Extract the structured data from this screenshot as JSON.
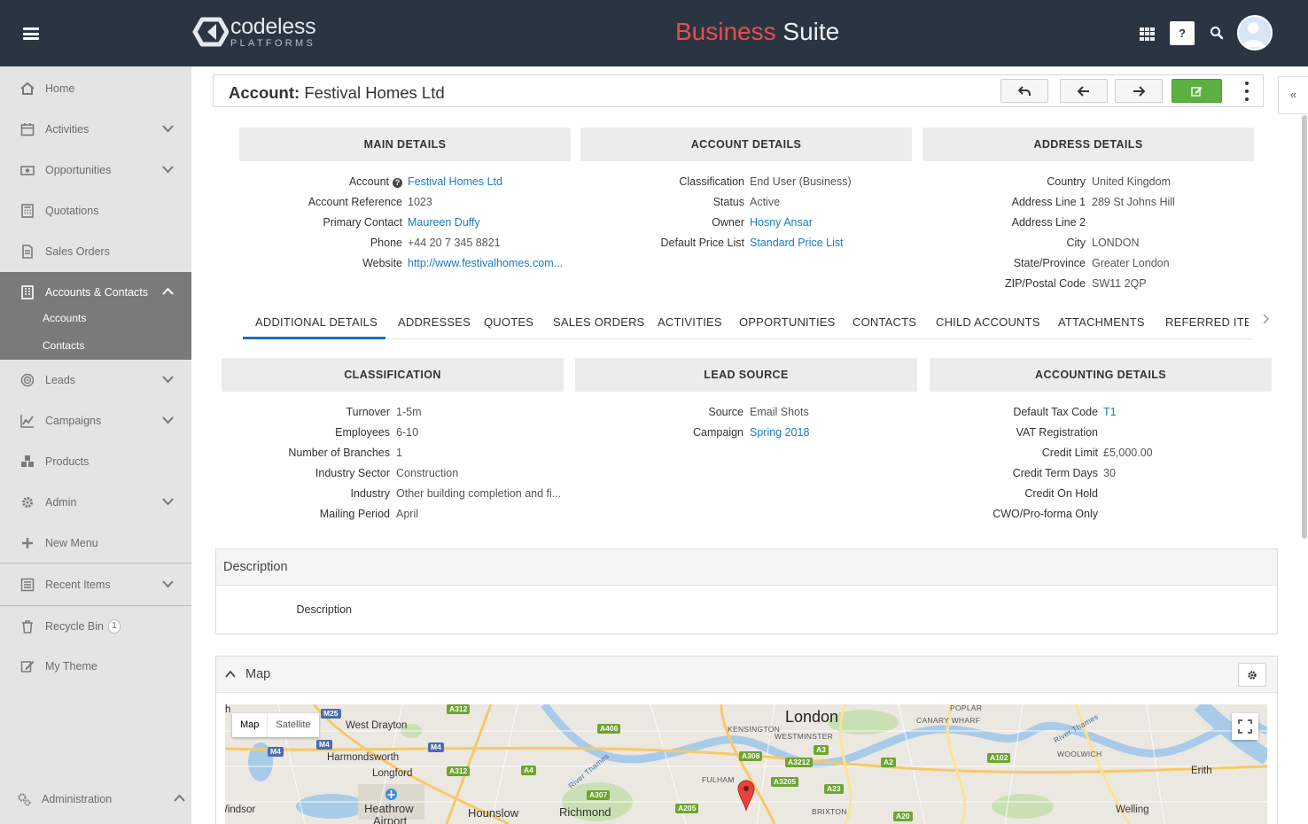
{
  "app": {
    "logo_main": "codeless",
    "logo_sub": "PLATFORMS",
    "title_part1": "Business",
    "title_part2": " Suite",
    "help_label": "?"
  },
  "colors": {
    "topbar": "#2b3542",
    "accent_red": "#e84d4d",
    "link": "#1a7bc4",
    "active_nav": "#7a7a7a",
    "active_indicator": "#1f6fb6",
    "edit_button": "#5cb040"
  },
  "sidebar": {
    "items": [
      {
        "label": "Home",
        "icon": "home-icon"
      },
      {
        "label": "Activities",
        "icon": "calendar-icon"
      },
      {
        "label": "Opportunities",
        "icon": "money-icon"
      },
      {
        "label": "Quotations",
        "icon": "calculator-icon"
      },
      {
        "label": "Sales Orders",
        "icon": "document-icon"
      },
      {
        "label": "Accounts & Contacts",
        "icon": "building-icon"
      },
      {
        "label": "Leads",
        "icon": "target-icon"
      },
      {
        "label": "Campaigns",
        "icon": "line-chart-icon"
      },
      {
        "label": "Products",
        "icon": "cubes-icon"
      },
      {
        "label": "Admin",
        "icon": "gear-icon"
      },
      {
        "label": "New Menu",
        "icon": "plus-icon"
      },
      {
        "label": "Recent Items",
        "icon": "list-icon"
      },
      {
        "label": "Recycle Bin",
        "icon": "trash-icon",
        "badge": "1"
      },
      {
        "label": "My Theme",
        "icon": "edit-icon"
      }
    ],
    "sub_items": [
      "Accounts",
      "Contacts"
    ],
    "footer_label": "Administration"
  },
  "record": {
    "type_label": "Account:",
    "name": "Festival Homes Ltd"
  },
  "sections": {
    "main_details": {
      "title": "MAIN DETAILS",
      "fields": [
        {
          "label": "Account",
          "value": "Festival Homes Ltd",
          "link": true,
          "help": true
        },
        {
          "label": "Account Reference",
          "value": "1023"
        },
        {
          "label": "Primary Contact",
          "value": "Maureen Duffy",
          "link": true
        },
        {
          "label": "Phone",
          "value": "+44 20 7 345 8821"
        },
        {
          "label": "Website",
          "value": "http://www.festivalhomes.com...",
          "link": true
        }
      ]
    },
    "account_details": {
      "title": "ACCOUNT DETAILS",
      "fields": [
        {
          "label": "Classification",
          "value": "End User (Business)"
        },
        {
          "label": "Status",
          "value": "Active"
        },
        {
          "label": "Owner",
          "value": "Hosny Ansar",
          "link": true
        },
        {
          "label": "Default Price List",
          "value": "Standard Price List",
          "link": true
        }
      ]
    },
    "address_details": {
      "title": "ADDRESS DETAILS",
      "fields": [
        {
          "label": "Country",
          "value": "United Kingdom"
        },
        {
          "label": "Address Line 1",
          "value": "289 St Johns Hill"
        },
        {
          "label": "Address Line 2",
          "value": ""
        },
        {
          "label": "City",
          "value": "LONDON"
        },
        {
          "label": "State/Province",
          "value": "Greater London"
        },
        {
          "label": "ZIP/Postal Code",
          "value": "SW11 2QP"
        }
      ]
    }
  },
  "tabs": [
    "ADDITIONAL DETAILS",
    "ADDRESSES",
    "QUOTES",
    "SALES ORDERS",
    "ACTIVITIES",
    "OPPORTUNITIES",
    "CONTACTS",
    "CHILD ACCOUNTS",
    "ATTACHMENTS",
    "REFERRED ITEMS"
  ],
  "additional": {
    "classification": {
      "title": "CLASSIFICATION",
      "fields": [
        {
          "label": "Turnover",
          "value": "1-5m"
        },
        {
          "label": "Employees",
          "value": "6-10"
        },
        {
          "label": "Number of Branches",
          "value": "1"
        },
        {
          "label": "Industry Sector",
          "value": "Construction"
        },
        {
          "label": "Industry",
          "value": "Other building completion and fi..."
        },
        {
          "label": "Mailing Period",
          "value": "April"
        }
      ]
    },
    "lead_source": {
      "title": "LEAD SOURCE",
      "fields": [
        {
          "label": "Source",
          "value": "Email Shots"
        },
        {
          "label": "Campaign",
          "value": "Spring 2018",
          "link": true
        }
      ]
    },
    "accounting": {
      "title": "ACCOUNTING DETAILS",
      "fields": [
        {
          "label": "Default Tax Code",
          "value": "T1",
          "link": true
        },
        {
          "label": "VAT Registration",
          "value": ""
        },
        {
          "label": "Credit Limit",
          "value": "£5,000.00"
        },
        {
          "label": "Credit Term Days",
          "value": "30"
        },
        {
          "label": "Credit On Hold",
          "value": ""
        },
        {
          "label": "CWO/Pro-forma Only",
          "value": ""
        }
      ]
    }
  },
  "description_panel": {
    "title": "Description",
    "field_label": "Description"
  },
  "map_panel": {
    "title": "Map",
    "type_map": "Map",
    "type_satellite": "Satellite",
    "places": {
      "london": "London",
      "west_drayton": "West Drayton",
      "harmondsworth": "Harmondsworth",
      "longford": "Longford",
      "heathrow": "Heathrow",
      "airport": "Airport",
      "hounslow": "Hounslow",
      "richmond": "Richmond",
      "windsor": "Windsor",
      "kensington": "KENSINGTON",
      "westminster": "WESTMINSTER",
      "fulham": "FULHAM",
      "brixton": "BRIXTON",
      "poplar": "POPLAR",
      "canary_wharf": "CANARY WHARF",
      "woolwich": "WOOLWICH",
      "erith": "Erith",
      "welling": "Welling",
      "river_thames": "River Thames",
      "h": "h"
    },
    "roads": [
      "M25",
      "M4",
      "M4",
      "M4",
      "A312",
      "A406",
      "A312",
      "A4",
      "A307",
      "A205",
      "A308",
      "A3212",
      "A3205",
      "A3",
      "A23",
      "A2",
      "A102",
      "A20"
    ]
  }
}
